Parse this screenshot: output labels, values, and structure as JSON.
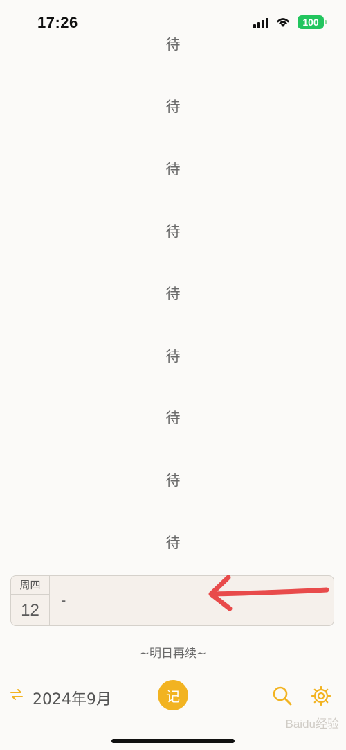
{
  "status_bar": {
    "time": "17:26",
    "battery": "100",
    "icons": [
      "signal-icon",
      "wifi-icon",
      "battery-icon"
    ]
  },
  "timeline": {
    "char": "待",
    "count": 9
  },
  "today_entry": {
    "weekday": "周四",
    "day": "12",
    "text": "-"
  },
  "continue_text": "~明日再续~",
  "toolbar": {
    "month_label": "2024年9月",
    "record_label": "记",
    "icons": [
      "swap-icon",
      "search-icon",
      "settings-icon"
    ]
  },
  "colors": {
    "accent": "#f2b321",
    "background": "#fbfaf8",
    "card": "#f5f0eb",
    "annotation": "#e84b4b"
  },
  "watermark": "Baidu经验"
}
